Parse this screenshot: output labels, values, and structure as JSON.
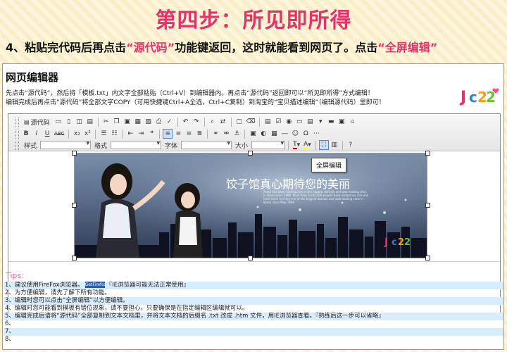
{
  "step_title": "第四步：所见即所得",
  "instruction": {
    "part1": "4、粘贴完代码后再点击",
    "highlight1": "“源代码”",
    "part2": "功能键返回，这时就能看到网页了。点击",
    "highlight2": "“全屏编辑”"
  },
  "panel": {
    "title": "网页编辑器",
    "desc_line1": "先点击“源代码”，然后将「模板.txt」内文字全部粘贴（Ctrl+V）到编辑器内。再点击“源代码”返回即可以“所见即所得”方式编辑！",
    "desc_line2": "编辑完成后再点击“源代码”将全部文字COPY（可用快捷键Ctrl+A全选，Ctrl+C复制）到淘宝的“宝贝描述编辑”（编辑源代码）里即可！"
  },
  "toolbar": {
    "source_label": "源代码",
    "bold": "B",
    "italic": "I",
    "underline": "U",
    "strike": "ABC",
    "subscript": "x₂",
    "superscript": "x²",
    "style_label": "样式",
    "format_label": "格式",
    "font_label": "字体",
    "size_label": "大小",
    "text_color": "T",
    "bg_color": "A",
    "help": "?"
  },
  "editor_content": {
    "banner_title": "饺子馆真心期待您的美丽",
    "banner_small": "Aside has been running one of the biggest domain and web hosting sites in korea since 1996. More than 3,000,000 people have visited our site and have been running one of the biggest domain and web hosting sites in Korea since May 1996.",
    "tooltip": "全屏编辑"
  },
  "tips": {
    "label": "Tips:",
    "items": [
      {
        "pre": "1、建议使用FireFox浏览器。",
        "badge": "GetFirefox",
        "post": "『IE浏览器可能无法正常使用』"
      },
      {
        "pre": "2、为方便编辑，请先了解下所有功能。",
        "badge": "",
        "post": ""
      },
      {
        "pre": "3、编辑时您可以点击“全屏编辑”以方便编辑。",
        "badge": "",
        "post": ""
      },
      {
        "pre": "4、编辑时您可能看到模板有错位现象，请不要担心，只要确保是在指定编辑区编辑就可以。",
        "badge": "",
        "post": ""
      },
      {
        "pre": "5、编辑完成后请将“源代码”全部复制到文本文档里，并将文本文档的后缀名 .txt 改成 .htm 文件，用IE浏览器查看。『熟练后这一步可以省略』",
        "badge": "",
        "post": ""
      },
      {
        "pre": "6、",
        "badge": "",
        "post": ""
      },
      {
        "pre": "7、",
        "badge": "",
        "post": ""
      },
      {
        "pre": "8、",
        "badge": "",
        "post": ""
      }
    ]
  },
  "colors": {
    "accent": "#e2336a",
    "tip_shade": "#d9ecfb"
  }
}
